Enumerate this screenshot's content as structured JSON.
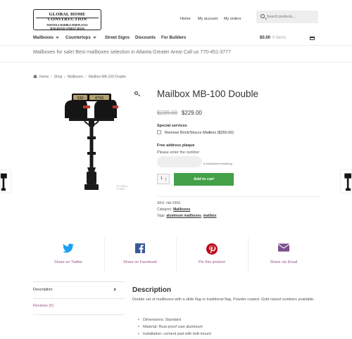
{
  "brand": {
    "logo_line1": "GLOBAL HOME CONSTRUCTION",
    "logo_line2": "MANTELS  MARBLE  FIREPLACES",
    "logo_line3": "MAILBOXES  STREET SIGNS"
  },
  "secondary_nav": {
    "items": [
      "Home",
      "My account",
      "My orders"
    ]
  },
  "search": {
    "placeholder": "Search products…"
  },
  "primary_nav": {
    "items": [
      {
        "label": "Mailboxes",
        "has_dropdown": true
      },
      {
        "label": "Countertops",
        "has_dropdown": true
      },
      {
        "label": "Street Signs",
        "has_dropdown": false
      },
      {
        "label": "Discounts",
        "has_dropdown": false
      },
      {
        "label": "For Builders",
        "has_dropdown": false
      }
    ]
  },
  "cart": {
    "amount": "$0.00",
    "items": "0 items"
  },
  "promo_text": "Mailboxes for sale! Best mailboxes selection in Atlanta Greater Area! Call us 770-451-3777",
  "breadcrumb": [
    "Home",
    "Shop",
    "Mailboxes",
    "Mailbox MB-100 Double"
  ],
  "product": {
    "title": "Mailbox MB-100 Double",
    "old_price": "$239.00",
    "price": "$229.00",
    "plaque_number": "4793",
    "watermark_line1": "GLOBAL",
    "watermark_line2": "HOME",
    "special_services_label": "Special services",
    "service_option": "Remove Brick/Stucco Mailbox ($250.00)",
    "plaque_label": "Free address plaque",
    "plaque_hint": "Please enter the number",
    "chars_remaining": "6 characters remaining",
    "quantity": "1",
    "add_to_cart": "Add to cart",
    "sku_label": "SKU:",
    "sku": "mb-100d",
    "category_label": "Category:",
    "category": "Mailboxes",
    "tags_label": "Tags:",
    "tags": [
      "aluminum mailboxes",
      "mailbox"
    ]
  },
  "share": [
    {
      "label": "Share on Twitter",
      "color": "#1da1f2",
      "icon": "twitter-icon"
    },
    {
      "label": "Share on Facebook",
      "color": "#3b5998",
      "icon": "facebook-icon"
    },
    {
      "label": "Pin this product",
      "color": "#bd081c",
      "icon": "pinterest-icon"
    },
    {
      "label": "Share via Email",
      "color": "#7b4f8f",
      "icon": "email-icon"
    }
  ],
  "tabs": {
    "items": [
      "Description",
      "Reviews (0)"
    ],
    "description_title": "Description",
    "description_text": "Double set of mailboxes with a slide flag or traditional flag. Powder coated. Gold raised numbers available.",
    "bullets": [
      "Dimensions: Standard",
      "Material: Rust proof cast aluminum",
      "Installation: cement pad with bolt-mount"
    ]
  },
  "colors": {
    "accent_green": "#43a047",
    "share_link": "#96588a",
    "text": "#43454b"
  }
}
